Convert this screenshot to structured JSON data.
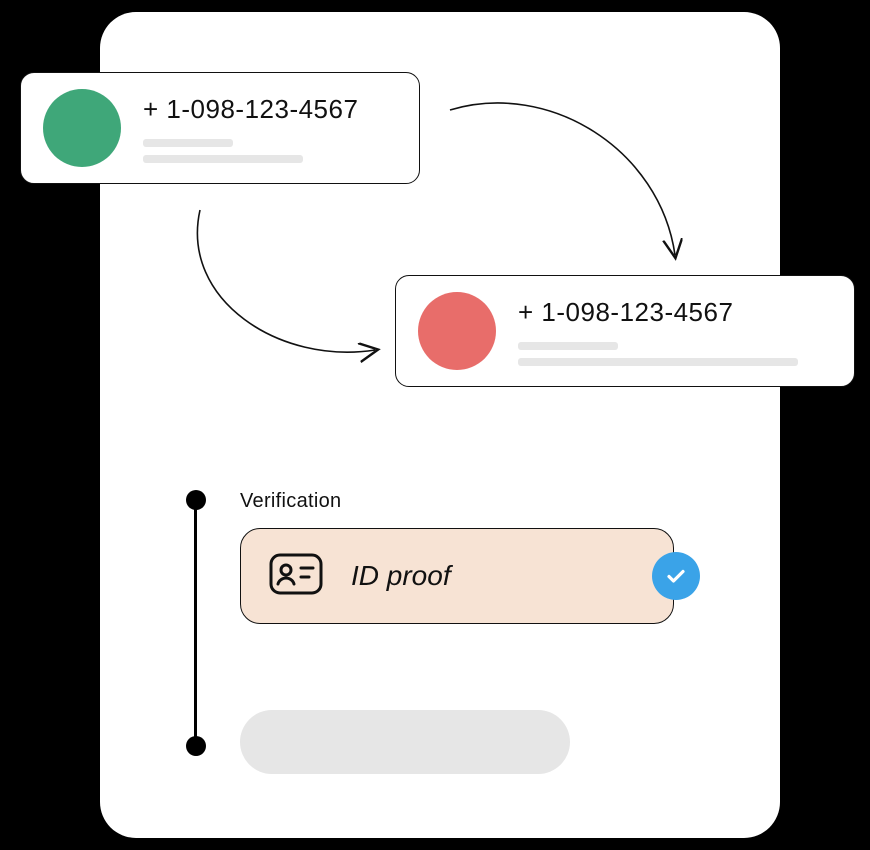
{
  "card_green": {
    "phone": "+ 1-098-123-4567",
    "avatar_color": "#3fa779"
  },
  "card_red": {
    "phone": "+ 1-098-123-4567",
    "avatar_color": "#e86d6a"
  },
  "verification": {
    "section_label": "Verification",
    "id_proof_label": "ID proof"
  }
}
